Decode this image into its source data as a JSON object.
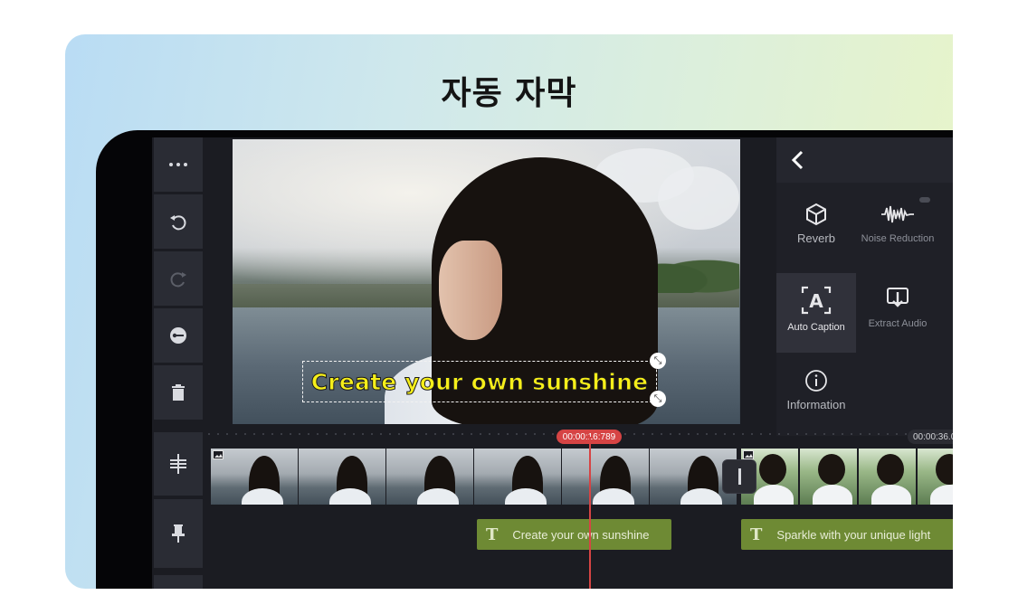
{
  "banner": {
    "title": "자동 자막"
  },
  "toolbar": {
    "buttons": [
      {
        "name": "more-icon",
        "enabled": true
      },
      {
        "name": "undo-icon",
        "enabled": true
      },
      {
        "name": "redo-icon",
        "enabled": false
      },
      {
        "name": "keyframe-icon",
        "enabled": true
      },
      {
        "name": "delete-icon",
        "enabled": true
      },
      {
        "name": "split-icon",
        "enabled": true
      },
      {
        "name": "pin-icon",
        "enabled": true
      }
    ]
  },
  "preview": {
    "caption_text": "Create your own sunshine"
  },
  "panel": {
    "back_icon": "chevron-left-icon",
    "items": [
      {
        "label": "Reverb",
        "icon": "cube-icon"
      },
      {
        "label": "Noise Reduction",
        "icon": "waveform-icon"
      },
      {
        "label": "Auto Caption",
        "icon": "auto-caption-icon",
        "active": true
      },
      {
        "label": "Extract Audio",
        "icon": "extract-audio-icon"
      },
      {
        "label": "Information",
        "icon": "info-icon"
      }
    ]
  },
  "timeline": {
    "current_time": "00:00:16:789",
    "end_time": "00:00:36.0",
    "caption_clips": [
      "Create your own sunshine",
      "Sparkle with your unique light"
    ]
  },
  "colors": {
    "accent_red": "#d64444",
    "caption_yellow": "#f6ef1a",
    "caption_clip_green": "#6e8a34"
  }
}
